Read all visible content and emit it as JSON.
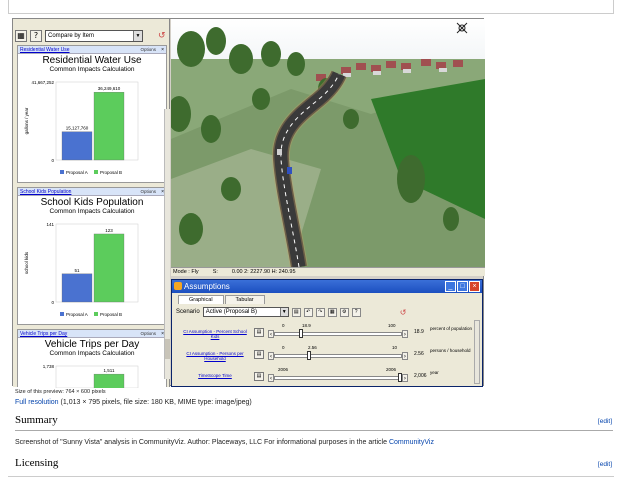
{
  "toolbar": {
    "compare_select": "Compare by Item"
  },
  "charts": [
    {
      "header_link": "Residential Water Use",
      "options_label": "Options",
      "title": "Residential Water Use",
      "subtitle": "Common Impacts Calculation",
      "ylabel": "gallons / year",
      "ymax_label": "41,667,252",
      "zero_label": "0",
      "bars": [
        {
          "name": "Proposal A",
          "value": 15127760,
          "label": "15,127,760",
          "color": "#4a72d0"
        },
        {
          "name": "Proposal B",
          "value": 36249610,
          "label": "36,249,610",
          "color": "#5ccc5c"
        }
      ],
      "ymax": 41667252
    },
    {
      "header_link": "School Kids Population",
      "options_label": "Options",
      "title": "School Kids Population",
      "subtitle": "Common Impacts Calculation",
      "ylabel": "school kids",
      "ymax_label": "141",
      "zero_label": "0",
      "bars": [
        {
          "name": "Proposal A",
          "value": 51,
          "label": "51",
          "color": "#4a72d0"
        },
        {
          "name": "Proposal B",
          "value": 123,
          "label": "123",
          "color": "#5ccc5c"
        }
      ],
      "ymax": 141
    },
    {
      "header_link": "Vehicle Trips per Day",
      "options_label": "Options",
      "title": "Vehicle Trips per Day",
      "subtitle": "Common Impacts Calculation",
      "ylabel": "",
      "ymax_label": "1,738",
      "zero_label": "",
      "bars": [
        {
          "name": "",
          "value": 1511,
          "label": "1,511",
          "color": "#5ccc5c"
        }
      ],
      "ymax": 1738
    }
  ],
  "statusbar": {
    "mode": "Mode : Fly",
    "s": "S:",
    "coords": "0.00  2: 2227.90  H: 240.95"
  },
  "dialog": {
    "title": "Assumptions",
    "tabs": [
      "Graphical",
      "Tabular"
    ],
    "scenario_label": "Scenario",
    "scenario_value": "Active (Proposal B)",
    "rows": [
      {
        "label": "CI Assumption - Percent School Kids",
        "min": "0",
        "max": "100",
        "current": "18.9",
        "value": "18.9",
        "unit": "percent of population",
        "fraction": 0.189
      },
      {
        "label": "CI Assumption - Persons per Household",
        "min": "0",
        "max": "10",
        "current": "2.56",
        "value": "2.56",
        "unit": "persons / household",
        "fraction": 0.256
      },
      {
        "label": "TimeScope Time",
        "min": "2006",
        "max": "2006",
        "current": "",
        "value": "2,006",
        "unit": "year",
        "fraction": 1.0
      }
    ]
  },
  "wiki": {
    "size_text": "Size of this preview: 764 × 600 pixels",
    "full_res_link": "Full resolution",
    "full_res_info": " (1,013 × 795 pixels, file size: 180 KB, MIME type: image/jpeg)",
    "summary_heading": "Summary",
    "edit_label": "[edit]",
    "description": "Screenshot of \"Sunny Vista\" analysis in CommunityViz. Author: Placeways, LLC For informational purposes in the article ",
    "description_link": "CommunityViz",
    "licensing_heading": "Licensing"
  }
}
